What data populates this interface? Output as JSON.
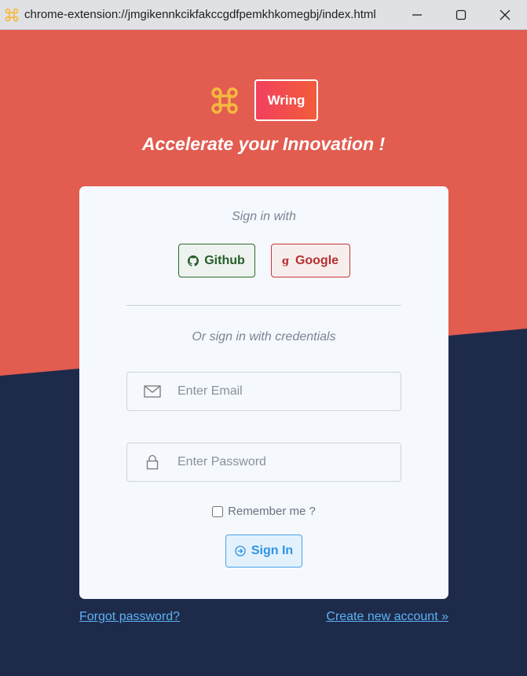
{
  "window": {
    "url": "chrome-extension://jmgikennkcikfakccgdfpemkhkomegbj/index.html",
    "favicon": "command-key-icon",
    "controls": [
      "minimize-icon",
      "maximize-icon",
      "close-icon"
    ]
  },
  "brand": {
    "logo_icon": "command-key-icon",
    "name": "Wring",
    "tagline": "Accelerate your Innovation !"
  },
  "login": {
    "sign_in_with": "Sign in with",
    "github_label": "Github",
    "github_icon": "github-icon",
    "google_label": "Google",
    "google_icon": "google-icon",
    "or_credentials": "Or sign in with credentials",
    "email_placeholder": "Enter Email",
    "email_icon": "envelope-icon",
    "password_placeholder": "Enter Password",
    "password_icon": "lock-icon",
    "remember_label": "Remember me ?",
    "remember_checked": false,
    "submit_label": "Sign In",
    "submit_icon": "login-arrow-icon"
  },
  "footer": {
    "forgot_password": "Forgot password?",
    "create_account": "Create new account »"
  },
  "colors": {
    "top_background": "#e25c50",
    "bottom_background": "#1e2a4a",
    "card": "#f5f8fc",
    "accent_link": "#5cb2f2",
    "brand_gradient_start": "#f2405e",
    "brand_gradient_end": "#f25c3a"
  }
}
